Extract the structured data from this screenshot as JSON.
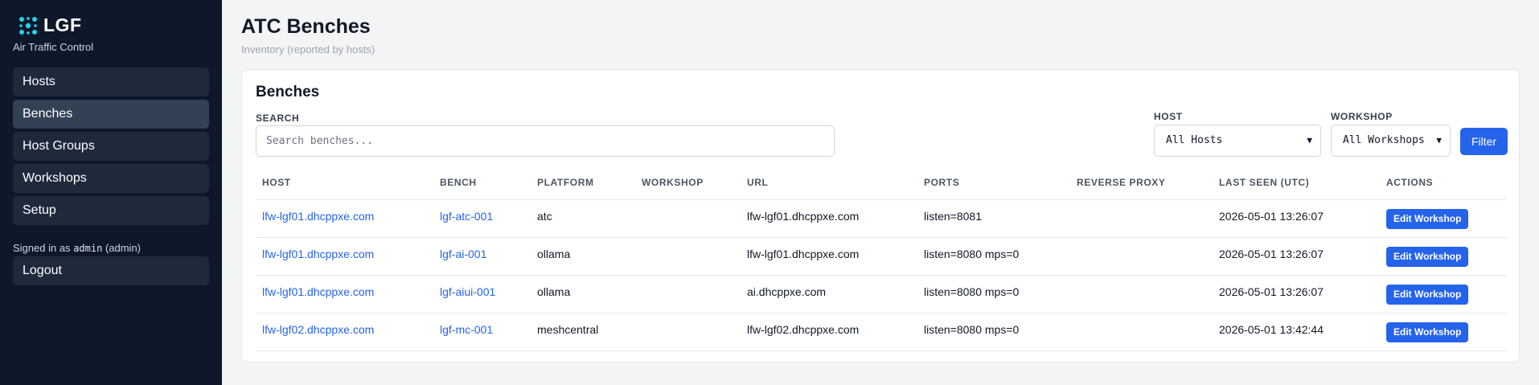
{
  "sidebar": {
    "brand": "LGF",
    "subtitle": "Air Traffic Control",
    "logo_icon": "network-nodes-icon",
    "accent_color": "#22d3ee",
    "items": [
      {
        "label": "Hosts",
        "active": false
      },
      {
        "label": "Benches",
        "active": true
      },
      {
        "label": "Host Groups",
        "active": false
      },
      {
        "label": "Workshops",
        "active": false
      },
      {
        "label": "Setup",
        "active": false
      }
    ],
    "signed_in_prefix": "Signed in as",
    "username": "admin",
    "role": "(admin)",
    "logout_label": "Logout"
  },
  "header": {
    "title": "ATC Benches",
    "subtitle": "Inventory (reported by hosts)"
  },
  "card": {
    "title": "Benches",
    "search_label": "SEARCH",
    "search_placeholder": "Search benches...",
    "host_label": "HOST",
    "host_selected": "All Hosts",
    "workshop_label": "WORKSHOP",
    "workshop_selected": "All Workshops",
    "filter_label": "Filter"
  },
  "table": {
    "columns": [
      "HOST",
      "BENCH",
      "PLATFORM",
      "WORKSHOP",
      "URL",
      "PORTS",
      "REVERSE PROXY",
      "LAST SEEN (UTC)",
      "ACTIONS"
    ],
    "action_label": "Edit Workshop",
    "rows": [
      {
        "host": "lfw-lgf01.dhcppxe.com",
        "bench": "lgf-atc-001",
        "platform": "atc",
        "workshop": "",
        "url": "lfw-lgf01.dhcppxe.com",
        "ports": "listen=8081",
        "reverse_proxy": "",
        "last_seen": "2026-05-01 13:26:07"
      },
      {
        "host": "lfw-lgf01.dhcppxe.com",
        "bench": "lgf-ai-001",
        "platform": "ollama",
        "workshop": "",
        "url": "lfw-lgf01.dhcppxe.com",
        "ports": "listen=8080 mps=0",
        "reverse_proxy": "",
        "last_seen": "2026-05-01 13:26:07"
      },
      {
        "host": "lfw-lgf01.dhcppxe.com",
        "bench": "lgf-aiui-001",
        "platform": "ollama",
        "workshop": "",
        "url": "ai.dhcppxe.com",
        "ports": "listen=8080 mps=0",
        "reverse_proxy": "",
        "last_seen": "2026-05-01 13:26:07"
      },
      {
        "host": "lfw-lgf02.dhcppxe.com",
        "bench": "lgf-mc-001",
        "platform": "meshcentral",
        "workshop": "",
        "url": "lfw-lgf02.dhcppxe.com",
        "ports": "listen=8080 mps=0",
        "reverse_proxy": "",
        "last_seen": "2026-05-01 13:42:44"
      }
    ]
  }
}
